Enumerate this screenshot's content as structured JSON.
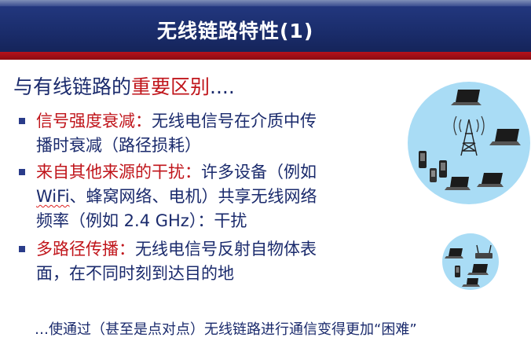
{
  "title": "无线链路特性(1)",
  "heading": {
    "prefix": "与有线链路的",
    "emphasis": "重要区别",
    "suffix": "...."
  },
  "bullets": [
    {
      "term": "信号强度衰减：",
      "line1": "无线电信号在介质中传",
      "line2": "播时衰减（路径损耗）"
    },
    {
      "term": "来自其他来源的干扰：",
      "line1": "许多设备（例如",
      "line2_wifi": "WiFi",
      "line2_rest": "、蜂窝网络、电机）共享无线网络",
      "line3": "频率（例如 2.4 GHz）：干扰"
    },
    {
      "term": "多路径传播：",
      "line1": "无线电信号反射自物体表",
      "line2": "面，在不同时刻到达目的地"
    }
  ],
  "footer": "…使通过（甚至是点对点）无线链路进行通信变得更加“困难”",
  "colors": {
    "banner": "#1a2c6a",
    "redbar": "#b6121b",
    "accent_red": "#c0151b",
    "text_blue": "#1a2a6c",
    "circle": "#a9dcf5"
  },
  "icons": [
    "cell-tower-icon",
    "laptop-icon",
    "smartphone-icon",
    "wireless-router-icon"
  ]
}
